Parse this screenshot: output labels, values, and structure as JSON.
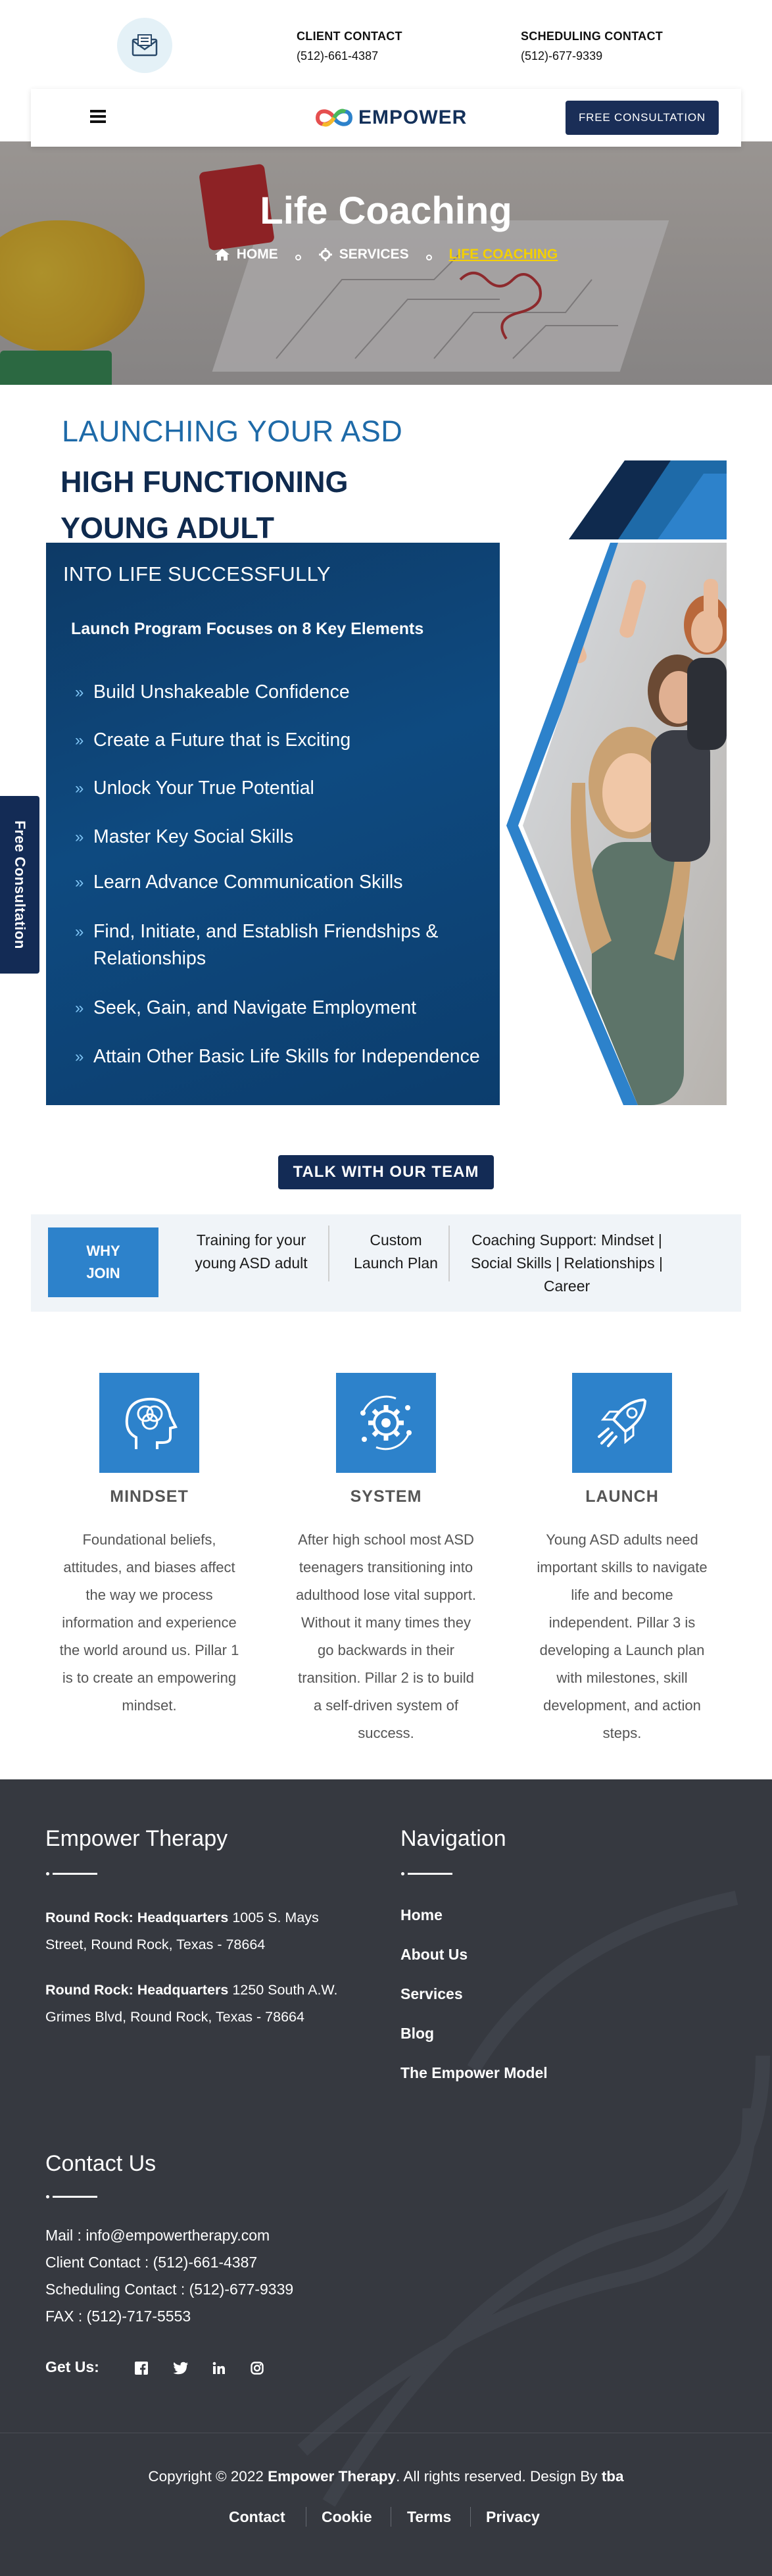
{
  "contacts": [
    {
      "label": "CLIENT CONTACT",
      "value": "(512)-661-4387"
    },
    {
      "label": "SCHEDULING CONTACT",
      "value": "(512)-677-9339"
    }
  ],
  "nav": {
    "logo_text": "EMPOWER",
    "consult_button": "FREE CONSULTATION"
  },
  "hero": {
    "title": "Life Coaching",
    "breadcrumbs": [
      "HOME",
      "SERVICES",
      "LIFE COACHING"
    ]
  },
  "program": {
    "heading_line1": "LAUNCHING YOUR ASD",
    "heading_line2": "HIGH FUNCTIONING",
    "heading_line3": "YOUNG ADULT",
    "subheading": "INTO LIFE SUCCESSFULLY",
    "focus_title": "Launch Program Focuses on 8 Key Elements",
    "elements": [
      "Build Unshakeable Confidence",
      "Create a Future that is Exciting",
      "Unlock Your True Potential",
      "Master Key Social Skills",
      "Learn Advance Communication Skills",
      "Find, Initiate, and Establish Friendships &",
      "Seek, Gain, and Navigate Employment",
      "Attain Other Basic Life Skills for Independence"
    ],
    "element_6_line2": "Relationships"
  },
  "talk_button": "TALK WITH OUR TEAM",
  "why": {
    "badge_line1": "WHY",
    "badge_line2": "JOIN",
    "item1_line1": "Training for your",
    "item1_line2": "young ASD adult",
    "item2_line1": "Custom",
    "item2_line2": "Launch Plan",
    "item3_line1": "Coaching Support: Mindset |",
    "item3_line2": "Social Skills | Relationships |",
    "item3_line3": "Career"
  },
  "pillars": [
    {
      "icon": "head-brain-icon",
      "title": "MINDSET",
      "lines": [
        "Foundational beliefs,",
        "attitudes, and biases affect",
        "the way we process",
        "information and experience",
        "the world around us. Pillar 1",
        "is to create an empowering",
        "mindset."
      ]
    },
    {
      "icon": "gear-cycle-icon",
      "title": "SYSTEM",
      "lines": [
        "After high school most ASD",
        "teenagers transitioning into",
        "adulthood lose vital support.",
        "Without it many times they",
        "go backwards in their",
        "transition. Pillar 2 is to build",
        "a self-driven system of",
        "success."
      ]
    },
    {
      "icon": "rocket-icon",
      "title": "LAUNCH",
      "lines": [
        "Young ASD adults need",
        "important skills to navigate",
        "life and become",
        "independent. Pillar 3 is",
        "developing a Launch plan",
        "with milestones, skill",
        "development, and action",
        "steps."
      ]
    }
  ],
  "footer": {
    "brand_heading": "Empower Therapy",
    "address1_bold": "Round Rock: Headquarters",
    "address1_rest_a": " 1005 S. Mays",
    "address1_rest_b": "Street, Round Rock, Texas - 78664",
    "address2_bold": "Round Rock: Headquarters",
    "address2_rest_a": " 1250 South A.W.",
    "address2_rest_b": "Grimes Blvd, Round Rock, Texas - 78664",
    "nav_heading": "Navigation",
    "nav_links": [
      "Home",
      "About Us",
      "Services",
      "Blog",
      "The Empower Model"
    ],
    "contact_heading": "Contact Us",
    "contact_lines": [
      "Mail : info@empowertherapy.com",
      "Client Contact : (512)-661-4387",
      "Scheduling Contact : (512)-677-9339",
      "FAX : (512)-717-5553"
    ],
    "get_us": "Get Us:",
    "social_icons": [
      "facebook-icon",
      "twitter-icon",
      "linkedin-icon",
      "instagram-icon"
    ],
    "copyright_pre": "Copyright © 2022 ",
    "copyright_brand": "Empower Therapy",
    "copyright_mid": ". All rights reserved. Design By ",
    "copyright_designer": "tba",
    "legal_links": [
      "Contact",
      "Cookie",
      "Terms",
      "Privacy"
    ]
  },
  "side_tab": "Free Consultation",
  "colors": {
    "navy": "#132b55",
    "accent_blue": "#2d82cb",
    "heading_blue": "#1e6aa8",
    "footer_bg": "#363940",
    "breadcrumb_active": "#f4d000"
  }
}
